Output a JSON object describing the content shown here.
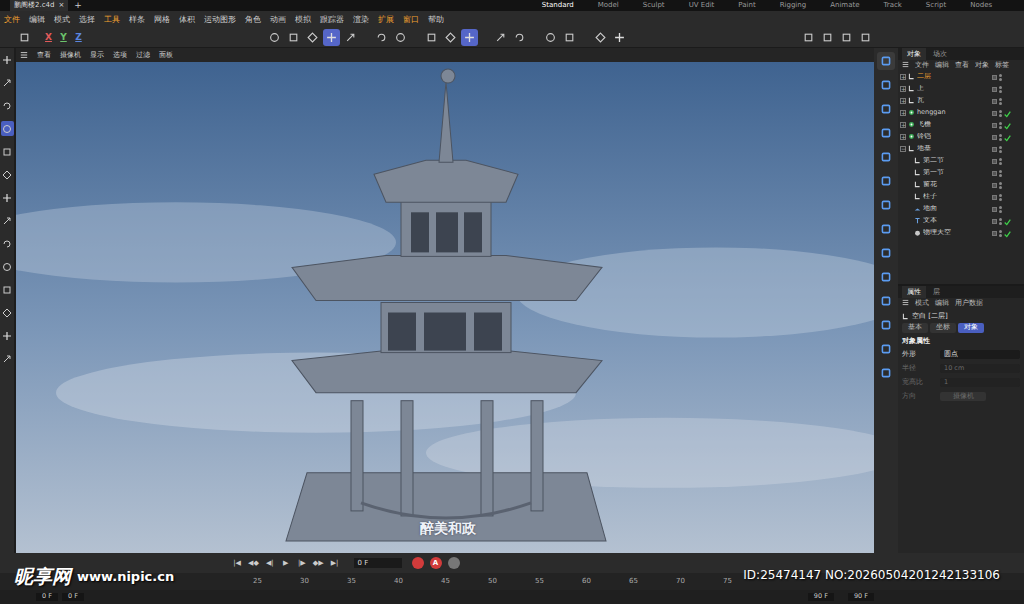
{
  "file_tabs": [
    {
      "label": "鹏阁楼2.c4d",
      "selected": true,
      "close": "×"
    }
  ],
  "new_tab": "+",
  "layouts": [
    {
      "label": "Standard",
      "selected": true
    },
    {
      "label": "Model",
      "selected": false
    },
    {
      "label": "Sculpt",
      "selected": false
    },
    {
      "label": "UV Edit",
      "selected": false
    },
    {
      "label": "Paint",
      "selected": false
    },
    {
      "label": "Rigging",
      "selected": false
    },
    {
      "label": "Animate",
      "selected": false
    },
    {
      "label": "Track",
      "selected": false
    },
    {
      "label": "Script",
      "selected": false
    },
    {
      "label": "Nodes",
      "selected": false
    }
  ],
  "menu": [
    {
      "label": "文件",
      "accent": true
    },
    {
      "label": "编辑",
      "accent": false
    },
    {
      "label": "模式",
      "accent": false
    },
    {
      "label": "选择",
      "accent": false
    },
    {
      "label": "工具",
      "accent": true
    },
    {
      "label": "样条",
      "accent": false
    },
    {
      "label": "网格",
      "accent": false
    },
    {
      "label": "体积",
      "accent": false
    },
    {
      "label": "运动图形",
      "accent": false
    },
    {
      "label": "角色",
      "accent": false
    },
    {
      "label": "动画",
      "accent": false
    },
    {
      "label": "模拟",
      "accent": false
    },
    {
      "label": "跟踪器",
      "accent": false
    },
    {
      "label": "渲染",
      "accent": false
    },
    {
      "label": "扩展",
      "accent": true
    },
    {
      "label": "窗口",
      "accent": true
    },
    {
      "label": "帮助",
      "accent": false
    }
  ],
  "toolbar": {
    "axes": [
      {
        "label": "X",
        "color": "#e05a5a"
      },
      {
        "label": "Y",
        "color": "#6cc46c"
      },
      {
        "label": "Z",
        "color": "#5a86e0"
      }
    ],
    "tools": [
      {
        "group": 1,
        "selected": false
      },
      {
        "group": 1,
        "selected": false
      },
      {
        "group": 1,
        "selected": false
      },
      {
        "group": 1,
        "selected": true
      },
      {
        "group": 1,
        "selected": false
      },
      {
        "group": 2,
        "selected": false
      },
      {
        "group": 2,
        "selected": false
      },
      {
        "group": 3,
        "selected": false
      },
      {
        "group": 3,
        "selected": false
      },
      {
        "group": 3,
        "selected": true
      },
      {
        "group": 4,
        "selected": false
      },
      {
        "group": 4,
        "selected": false
      },
      {
        "group": 5,
        "selected": false
      },
      {
        "group": 5,
        "selected": false
      },
      {
        "group": 6,
        "selected": false
      },
      {
        "group": 6,
        "selected": false
      }
    ]
  },
  "left_tools": [
    {
      "selected": false
    },
    {
      "selected": false
    },
    {
      "selected": false
    },
    {
      "selected": true
    },
    {
      "selected": false
    },
    {
      "selected": false
    },
    {
      "selected": false
    },
    {
      "selected": false
    },
    {
      "selected": false
    },
    {
      "selected": false
    },
    {
      "selected": false
    },
    {
      "selected": false
    },
    {
      "selected": false
    },
    {
      "selected": false
    }
  ],
  "viewport": {
    "menu": [
      "查看",
      "摄像机",
      "显示",
      "选项",
      "过滤",
      "面板"
    ],
    "scene_text": "醉美和政"
  },
  "right_tools": [
    {
      "selected": true
    },
    {
      "selected": false
    },
    {
      "selected": false
    },
    {
      "selected": false
    },
    {
      "selected": false
    },
    {
      "selected": false
    },
    {
      "selected": false
    },
    {
      "selected": false
    },
    {
      "selected": false
    },
    {
      "selected": false
    },
    {
      "selected": false
    },
    {
      "selected": false
    },
    {
      "selected": false
    },
    {
      "selected": false
    }
  ],
  "objects": {
    "tabs": [
      {
        "label": "对象",
        "selected": true
      },
      {
        "label": "场次",
        "selected": false
      }
    ],
    "menu": [
      "文件",
      "编辑",
      "查看",
      "对象",
      "标签"
    ],
    "items": [
      {
        "name": "二层",
        "kind": "null",
        "selected": true,
        "expanded": false,
        "checked": false,
        "children": []
      },
      {
        "name": "上",
        "kind": "null",
        "selected": false,
        "expanded": false,
        "checked": false,
        "children": []
      },
      {
        "name": "瓦",
        "kind": "null",
        "selected": false,
        "expanded": false,
        "checked": false,
        "children": []
      },
      {
        "name": "henggan",
        "kind": "generator",
        "selected": false,
        "expanded": false,
        "checked": true,
        "children": []
      },
      {
        "name": "飞檐",
        "kind": "generator",
        "selected": false,
        "expanded": false,
        "checked": true,
        "children": []
      },
      {
        "name": "铃铛",
        "kind": "generator",
        "selected": false,
        "expanded": false,
        "checked": true,
        "children": []
      },
      {
        "name": "地基",
        "kind": "null",
        "selected": false,
        "expanded": true,
        "checked": false,
        "children": [
          {
            "name": "第二节",
            "kind": "null",
            "selected": false,
            "checked": false
          },
          {
            "name": "第一节",
            "kind": "null",
            "selected": false,
            "checked": false
          },
          {
            "name": "窗花",
            "kind": "null",
            "selected": false,
            "checked": false
          },
          {
            "name": "柱子",
            "kind": "null",
            "selected": false,
            "checked": false
          },
          {
            "name": "地面",
            "kind": "floor",
            "selected": false,
            "checked": false
          },
          {
            "name": "文本",
            "kind": "text",
            "selected": false,
            "checked": true
          },
          {
            "name": "物理天空",
            "kind": "sky",
            "selected": false,
            "checked": true
          }
        ]
      }
    ]
  },
  "attributes": {
    "tabs": [
      {
        "label": "属性",
        "selected": true
      },
      {
        "label": "层",
        "selected": false
      }
    ],
    "menu": [
      "模式",
      "编辑",
      "用户数据"
    ],
    "title": "空白 [二层]",
    "subtabs": [
      {
        "label": "基本",
        "selected": false
      },
      {
        "label": "坐标",
        "selected": false
      },
      {
        "label": "对象",
        "selected": true
      }
    ],
    "section": "对象属性",
    "fields": [
      {
        "label": "外形",
        "value": "圆点",
        "kind": "dropdown",
        "disabled": false
      },
      {
        "label": "半径",
        "value": "10 cm",
        "kind": "number",
        "disabled": true
      },
      {
        "label": "宽高比",
        "value": "1",
        "kind": "number",
        "disabled": true
      },
      {
        "label": "方向",
        "value": "摄像机",
        "kind": "button",
        "disabled": true
      }
    ]
  },
  "timeline": {
    "transport": [
      {
        "label": "|◀",
        "selected": false
      },
      {
        "label": "◀◆",
        "selected": false
      },
      {
        "label": "◀|",
        "selected": false
      },
      {
        "label": "▶",
        "selected": false
      },
      {
        "label": "|▶",
        "selected": false
      },
      {
        "label": "◆▶",
        "selected": false
      },
      {
        "label": "▶|",
        "selected": false
      }
    ],
    "frame": "0 F",
    "auto_key": "A",
    "ruler": [
      "25",
      "30",
      "35",
      "40",
      "45",
      "50",
      "55",
      "60",
      "65",
      "70",
      "75"
    ],
    "start": "0 F",
    "preview_start": "0 F",
    "preview_end": "90 F",
    "end": "90 F"
  },
  "watermark": {
    "logo": "昵享网",
    "url": "www.nipic.cn",
    "id": "ID:25474147 NO:20260504201242133106"
  }
}
